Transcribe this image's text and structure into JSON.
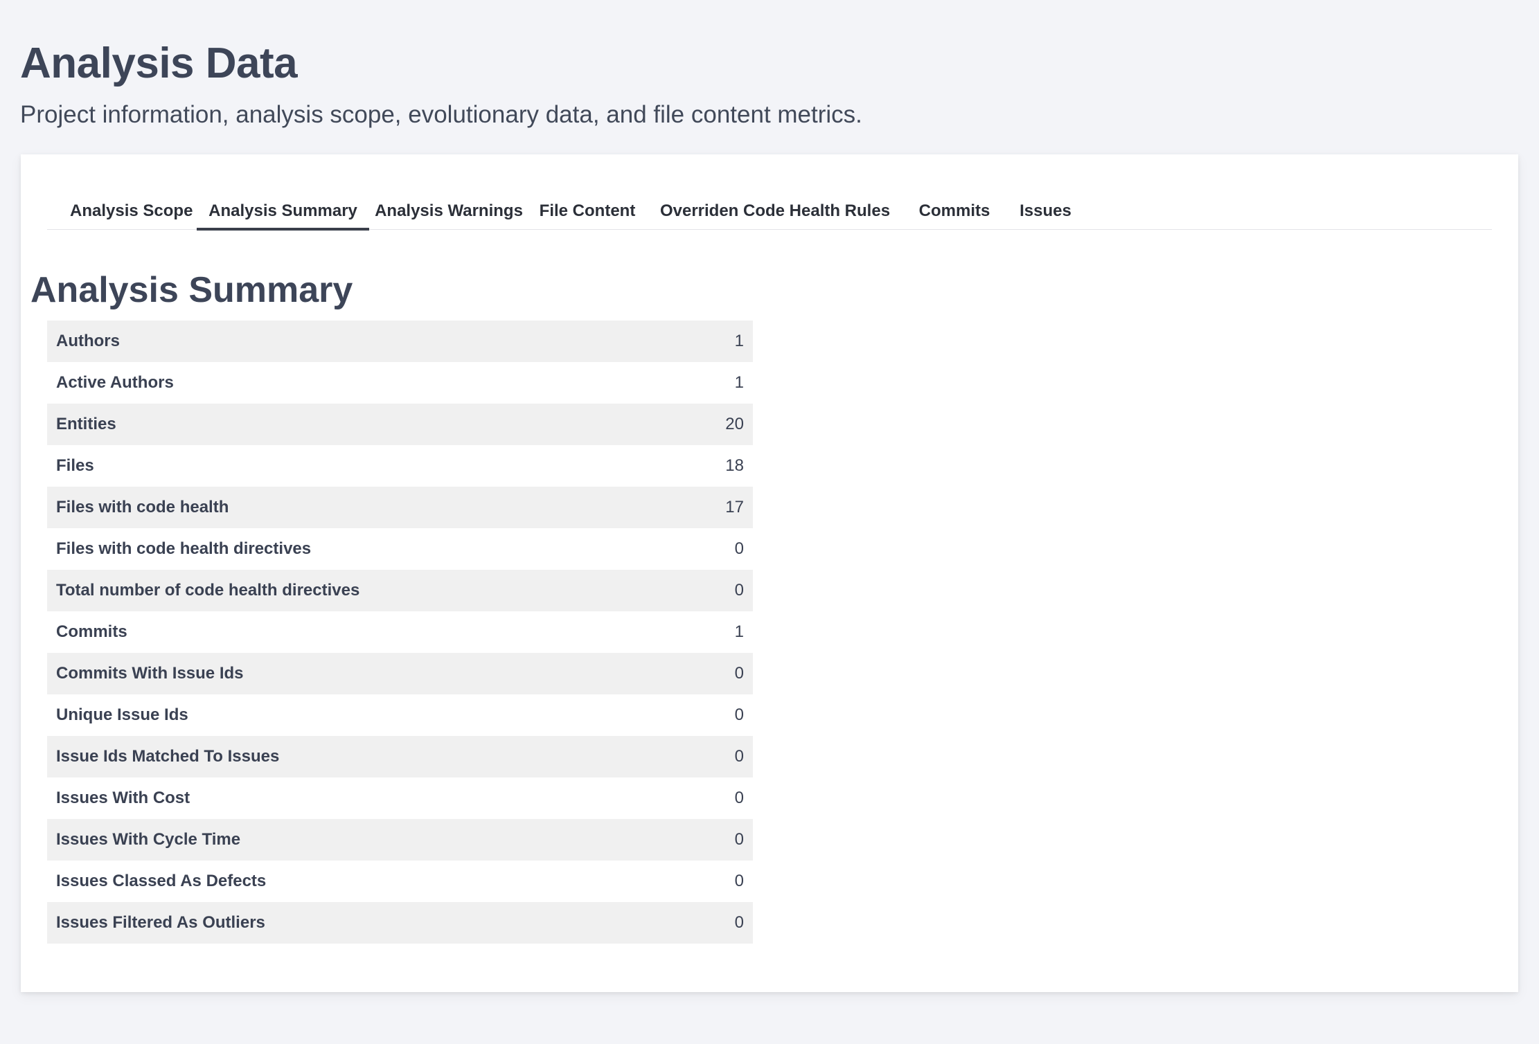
{
  "page": {
    "title": "Analysis Data",
    "subtitle": "Project information, analysis scope, evolutionary data, and file content metrics."
  },
  "tabs": [
    {
      "label": "Analysis Scope",
      "active": false
    },
    {
      "label": "Analysis Summary",
      "active": true
    },
    {
      "label": "Analysis Warnings",
      "active": false
    },
    {
      "label": "File Content",
      "active": false
    },
    {
      "label": "Overriden Code Health Rules",
      "active": false
    },
    {
      "label": "Commits",
      "active": false
    },
    {
      "label": "Issues",
      "active": false
    }
  ],
  "summary": {
    "title": "Analysis Summary",
    "rows": [
      {
        "label": "Authors",
        "value": "1"
      },
      {
        "label": "Active Authors",
        "value": "1"
      },
      {
        "label": "Entities",
        "value": "20"
      },
      {
        "label": "Files",
        "value": "18"
      },
      {
        "label": "Files with code health",
        "value": "17"
      },
      {
        "label": "Files with code health directives",
        "value": "0"
      },
      {
        "label": "Total number of code health directives",
        "value": "0"
      },
      {
        "label": "Commits",
        "value": "1"
      },
      {
        "label": "Commits With Issue Ids",
        "value": "0"
      },
      {
        "label": "Unique Issue Ids",
        "value": "0"
      },
      {
        "label": "Issue Ids Matched To Issues",
        "value": "0"
      },
      {
        "label": "Issues With Cost",
        "value": "0"
      },
      {
        "label": "Issues With Cycle Time",
        "value": "0"
      },
      {
        "label": "Issues Classed As Defects",
        "value": "0"
      },
      {
        "label": "Issues Filtered As Outliers",
        "value": "0"
      }
    ]
  }
}
